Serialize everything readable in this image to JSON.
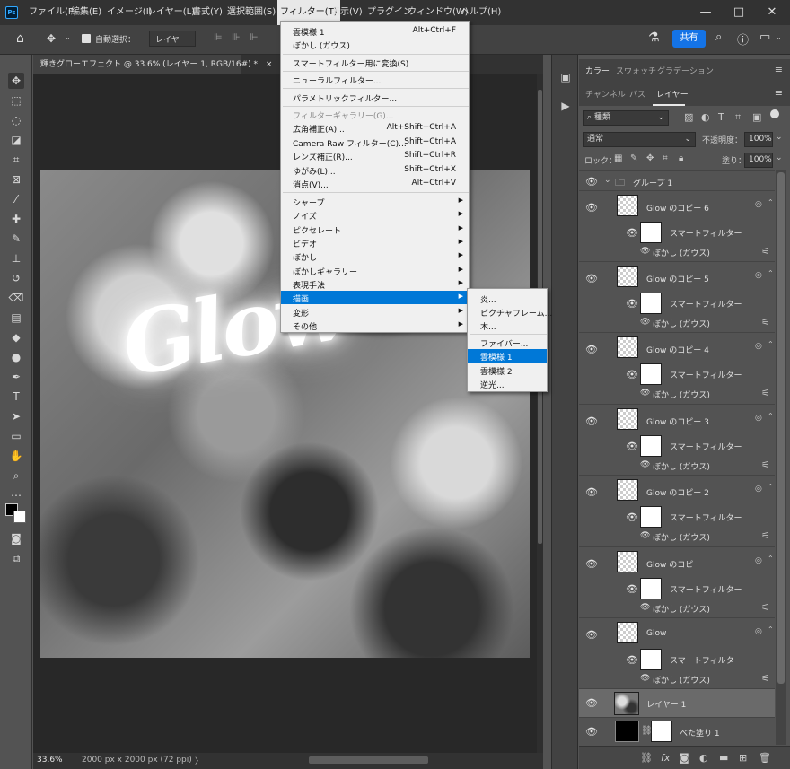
{
  "app": {
    "logo": "Ps"
  },
  "menubar": {
    "items": [
      "ファイル(F)",
      "編集(E)",
      "イメージ(I)",
      "レイヤー(L)",
      "書式(Y)",
      "選択範囲(S)",
      "フィルター(T)",
      "表示(V)",
      "プラグイン",
      "ウィンドウ(W)",
      "ヘルプ(H)"
    ],
    "open_item": "フィルター(T)",
    "window_controls": {
      "minimize": "—",
      "maximize": "□",
      "close": "✕"
    }
  },
  "options_bar": {
    "auto_select_label": "自動選択：",
    "auto_select_value": "レイヤー",
    "share_label": "共有"
  },
  "document": {
    "tab_title": "輝きグローエフェクト @ 33.6% (レイヤー 1, RGB/16#) *",
    "tab_close": "×",
    "canvas_text": "Glow",
    "zoom": "33.6%",
    "dimensions": "2000 px x 2000 px (72 ppi)",
    "status_arrow": "〉"
  },
  "filter_menu": {
    "top_items": [
      {
        "label": "雲模様 1",
        "shortcut": "Alt+Ctrl+F"
      },
      {
        "label": "ぼかし (ガウス)",
        "shortcut": ""
      }
    ],
    "convert_smart": "スマートフィルター用に変換(S)",
    "neural": "ニューラルフィルター...",
    "parametric": "パラメトリックフィルター...",
    "gallery": "フィルターギャラリー(G)...",
    "dialog_items": [
      {
        "label": "広角補正(A)...",
        "shortcut": "Alt+Shift+Ctrl+A"
      },
      {
        "label": "Camera Raw フィルター(C)...",
        "shortcut": "Shift+Ctrl+A"
      },
      {
        "label": "レンズ補正(R)...",
        "shortcut": "Shift+Ctrl+R"
      },
      {
        "label": "ゆがみ(L)...",
        "shortcut": "Shift+Ctrl+X"
      },
      {
        "label": "消点(V)...",
        "shortcut": "Alt+Ctrl+V"
      }
    ],
    "submenus": [
      "シャープ",
      "ノイズ",
      "ピクセレート",
      "ビデオ",
      "ぼかし",
      "ぼかしギャラリー",
      "表現手法",
      "描画",
      "変形",
      "その他"
    ],
    "highlighted_submenu": "描画"
  },
  "render_submenu": {
    "group1": [
      "炎...",
      "ピクチャフレーム...",
      "木..."
    ],
    "group2": [
      "ファイバー...",
      "雲模様 1",
      "雲模様 2",
      "逆光..."
    ],
    "highlighted": "雲模様 1"
  },
  "panels": {
    "top_tabs": [
      "カラー",
      "スウォッチ",
      "グラデーション"
    ],
    "layer_tabs": [
      "チャンネル",
      "パス",
      "レイヤー"
    ],
    "filter_kind": "種類",
    "blend_mode": "通常",
    "opacity_label": "不透明度：",
    "opacity_value": "100%",
    "lock_label": "ロック：",
    "fill_label": "塗り：",
    "fill_value": "100%",
    "menu_icon": "≡"
  },
  "layers": {
    "group_name": "グループ 1",
    "smart_filter_label": "スマートフィルター",
    "filter_item_label": "ぼかし (ガウス)",
    "items": [
      {
        "name": "Glow のコピー 6"
      },
      {
        "name": "Glow のコピー 5"
      },
      {
        "name": "Glow のコピー 4"
      },
      {
        "name": "Glow のコピー 3"
      },
      {
        "name": "Glow のコピー 2"
      },
      {
        "name": "Glow のコピー"
      },
      {
        "name": "Glow"
      }
    ],
    "layer1_name": "レイヤー 1",
    "fill_layer_name": "べた塗り 1"
  }
}
